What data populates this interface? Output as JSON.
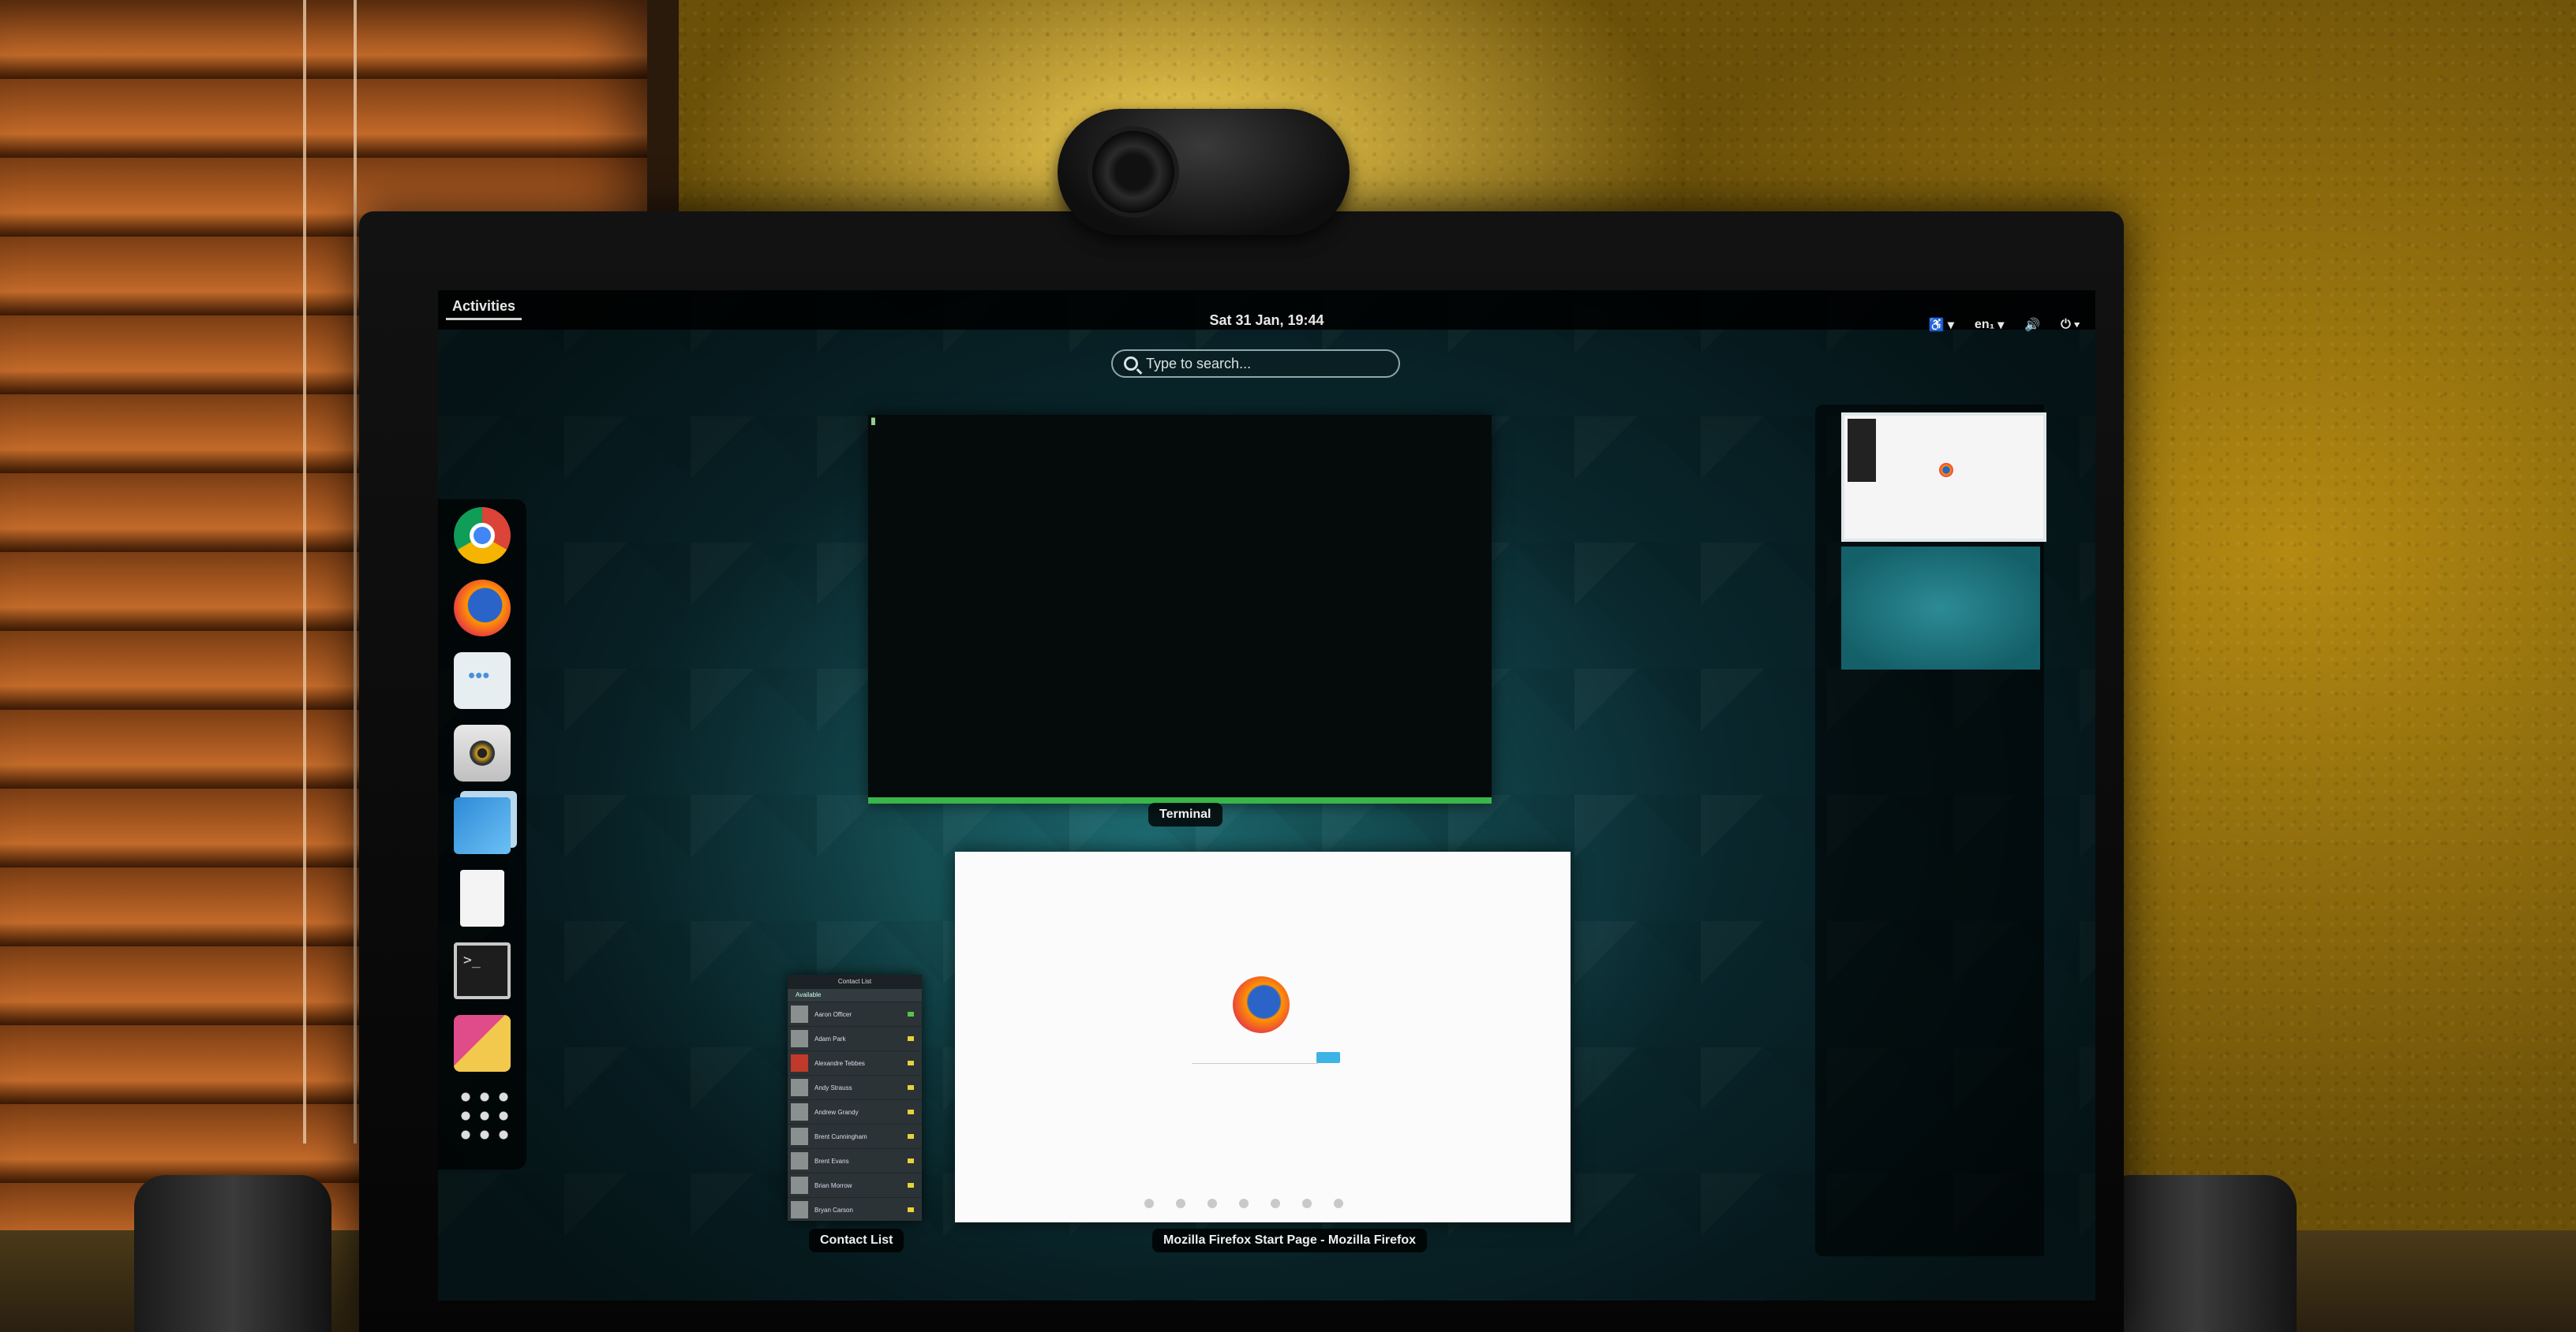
{
  "topbar": {
    "activities": "Activities",
    "clock": "Sat 31 Jan, 19:44",
    "accessibility_icon": "accessibility-icon",
    "language": "en₁",
    "volume_icon": "volume-icon",
    "power_icon": "power-icon"
  },
  "search": {
    "placeholder": "Type to search..."
  },
  "dash": {
    "items": [
      "chrome-icon",
      "firefox-icon",
      "chat-icon",
      "rhythmbox-icon",
      "photos-icon",
      "files-icon",
      "terminal-icon",
      "pidgin-drink-icon",
      "show-apps-icon"
    ]
  },
  "windows": {
    "terminal_caption": "Terminal",
    "firefox_caption": "Mozilla Firefox Start Page - Mozilla Firefox",
    "contacts_caption": "Contact List",
    "contacts_title": "Contact List",
    "contacts_status": "Available",
    "contacts": [
      "Aaron Officer",
      "Adam Park",
      "Alexandre Tebbes",
      "Andy Strauss",
      "Andrew Grandy",
      "Brent Cunningham",
      "Brent Evans",
      "Brian Morrow",
      "Bryan Carson"
    ]
  },
  "colors": {
    "screen_bg": "#0c2f34",
    "terminal_accent": "#39b54a",
    "search_button": "#3db3e6"
  }
}
